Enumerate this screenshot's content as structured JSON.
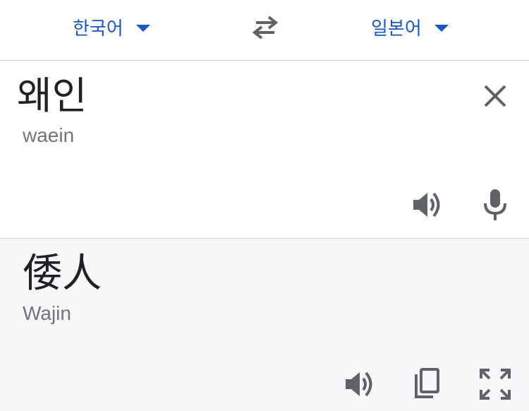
{
  "language_bar": {
    "source_language": "한국어",
    "target_language": "일본어",
    "swap_icon": "swap-arrows-icon",
    "accent_color": "#1a56c4"
  },
  "input": {
    "text": "왜인",
    "transliteration": "waein",
    "clear_icon": "close-icon",
    "speaker_icon": "speaker-icon",
    "mic_icon": "microphone-icon"
  },
  "output": {
    "text": "倭人",
    "transliteration": "Wajin",
    "speaker_icon": "speaker-icon",
    "copy_icon": "copy-icon",
    "fullscreen_icon": "fullscreen-icon",
    "background_color": "#f7f7f9"
  }
}
